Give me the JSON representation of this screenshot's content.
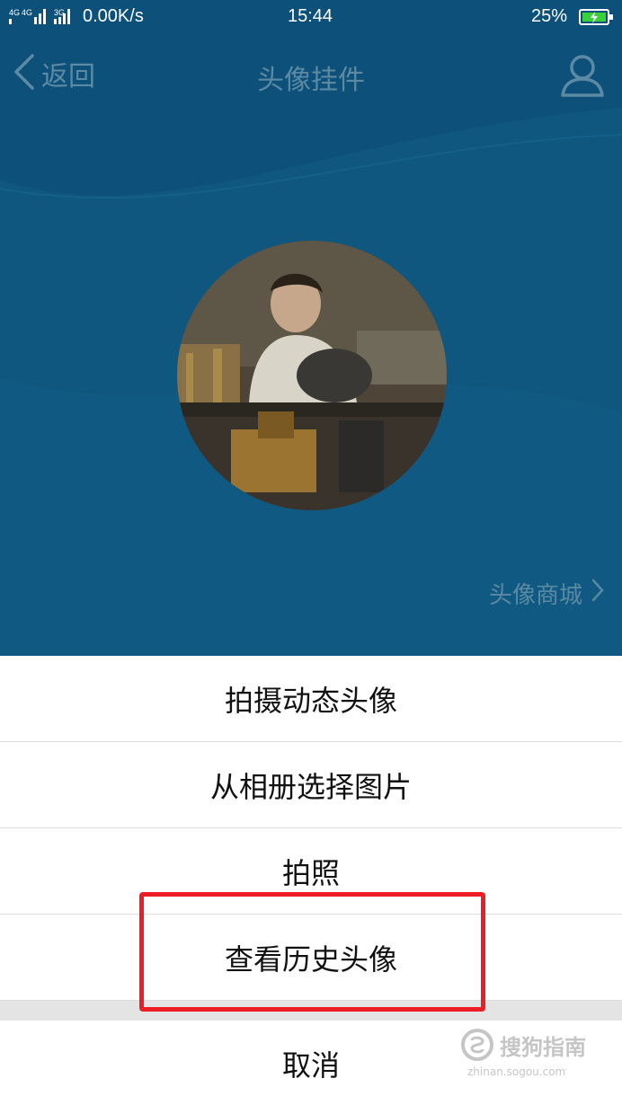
{
  "status_bar": {
    "network": "4G 4G 3G",
    "speed": "0.00K/s",
    "time": "15:44",
    "battery_percent": "25%"
  },
  "nav": {
    "back_label": "返回",
    "title": "头像挂件"
  },
  "avatar_mall_label": "头像商城",
  "action_sheet": {
    "items": [
      {
        "label": "拍摄动态头像"
      },
      {
        "label": "从相册选择图片"
      },
      {
        "label": "拍照"
      },
      {
        "label": "查看历史头像"
      }
    ],
    "cancel_label": "取消"
  },
  "watermark": {
    "text": "搜狗指南",
    "url": "zhinan.sogou.com"
  },
  "colors": {
    "header_bg": "#0f577f",
    "nav_text": "#5c8aa4",
    "highlight_border": "#ee1c24"
  }
}
